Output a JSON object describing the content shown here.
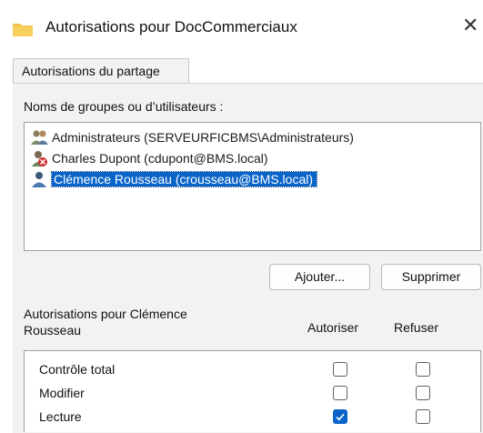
{
  "window": {
    "title": "Autorisations pour DocCommerciaux",
    "close_glyph": "✕"
  },
  "tabs": [
    {
      "label": "Autorisations du partage"
    }
  ],
  "users_section": {
    "label": "Noms de groupes ou d’utilisateurs :",
    "items": [
      {
        "icon": "group-icon",
        "text": "Administrateurs (SERVEURFICBMS\\Administrateurs)",
        "selected": false
      },
      {
        "icon": "user-disabled-icon",
        "text": "Charles Dupont (cdupont@BMS.local)",
        "selected": false
      },
      {
        "icon": "user-icon",
        "text": "Clémence Rousseau (crousseau@BMS.local)",
        "selected": true
      }
    ]
  },
  "buttons": {
    "add": "Ajouter...",
    "remove": "Supprimer"
  },
  "permissions": {
    "label_line1": "Autorisations pour Clémence",
    "label_line2": "Rousseau",
    "col_allow": "Autoriser",
    "col_deny": "Refuser",
    "rows": [
      {
        "name": "Contrôle total",
        "allow": false,
        "deny": false
      },
      {
        "name": "Modifier",
        "allow": false,
        "deny": false
      },
      {
        "name": "Lecture",
        "allow": true,
        "deny": false
      }
    ]
  },
  "colors": {
    "selection": "#0a64c8",
    "panel": "#f2f2f2",
    "folder": "#f4c24a"
  }
}
